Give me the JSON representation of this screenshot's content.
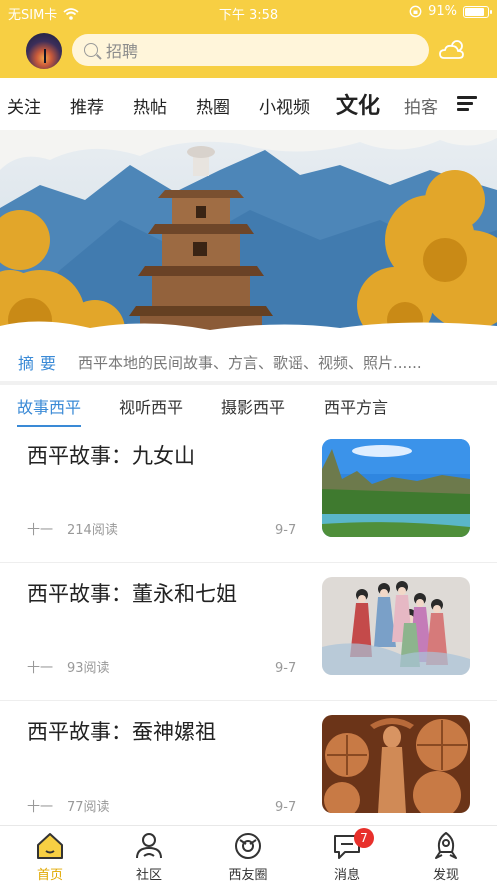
{
  "status_bar": {
    "carrier": "无SIM卡",
    "time": "下午 3:58",
    "battery": "91%",
    "battery_level": 0.91
  },
  "header": {
    "search_placeholder": "招聘",
    "avatar_icon": "avatar-sunset-image",
    "weather_icon": "cloud-sun-icon"
  },
  "tabs": [
    {
      "label": "关注"
    },
    {
      "label": "推荐"
    },
    {
      "label": "热帖"
    },
    {
      "label": "热圈"
    },
    {
      "label": "小视频"
    },
    {
      "label": "文化",
      "active": true
    },
    {
      "label": "拍客"
    }
  ],
  "summary": {
    "label": "摘要",
    "text": "西平本地的民间故事、方言、歌谣、视频、照片......"
  },
  "subtabs": [
    {
      "label": "故事西平",
      "active": true
    },
    {
      "label": "视听西平"
    },
    {
      "label": "摄影西平"
    },
    {
      "label": "西平方言"
    }
  ],
  "articles": [
    {
      "title": "西平故事：九女山",
      "author": "十一",
      "reads": "214阅读",
      "date": "9-7",
      "thumb": "mountain-lake-photo"
    },
    {
      "title": "西平故事：董永和七姐",
      "author": "十一",
      "reads": "93阅读",
      "date": "9-7",
      "thumb": "fairies-painting"
    },
    {
      "title": "西平故事：蚕神嫘祖",
      "author": "十一",
      "reads": "77阅读",
      "date": "9-7",
      "thumb": "silk-goddess-carving"
    }
  ],
  "bottom_nav": [
    {
      "label": "首页",
      "icon": "home-icon",
      "active": true
    },
    {
      "label": "社区",
      "icon": "community-icon"
    },
    {
      "label": "西友圈",
      "icon": "friends-circle-icon"
    },
    {
      "label": "消息",
      "icon": "message-icon",
      "badge": "7"
    },
    {
      "label": "发现",
      "icon": "rocket-icon"
    }
  ],
  "colors": {
    "brand_yellow": "#f7cf43",
    "accent_blue": "#3a8ad6",
    "badge_red": "#e8302b"
  }
}
